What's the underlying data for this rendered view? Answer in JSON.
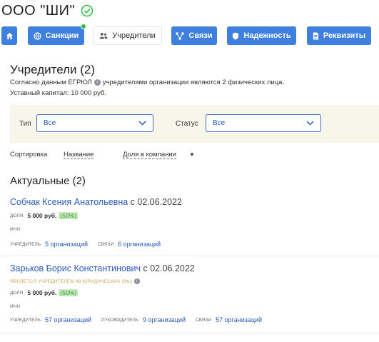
{
  "header": {
    "company_name": "ООО \"ШИ\"",
    "verified_icon": "check-circle-icon"
  },
  "tabs": [
    {
      "label": "",
      "icon": "home-icon"
    },
    {
      "label": "Санкции",
      "icon": "globe-icon",
      "badge": "green-dot"
    },
    {
      "label": "Учредители",
      "icon": "people-icon",
      "active": true
    },
    {
      "label": "Связи",
      "icon": "share-icon"
    },
    {
      "label": "Надежность",
      "icon": "shield-icon"
    },
    {
      "label": "Реквизиты",
      "icon": "document-icon"
    }
  ],
  "summary": {
    "title": "Учредители (2)",
    "text_before": "Согласно данным ЕГРЮЛ",
    "info_glyph": "i",
    "text_after": "учредителями организации являются 2 физических лица.",
    "capital": "Уставный капитал: 10 000 руб."
  },
  "filters": {
    "type_label": "Тип",
    "type_value": "Все",
    "status_label": "Статус",
    "status_value": "Все"
  },
  "sort": {
    "label": "Сортировка",
    "option1": "Название",
    "option2": "Доля в компании",
    "arrow": "▼"
  },
  "section": {
    "title": "Актуальные (2)"
  },
  "founders": [
    {
      "name": "Собчак Ксения Анатольевна",
      "since": "с 02.06.2022",
      "share_label": "ДОЛЯ",
      "share_amount": "5 000 руб.",
      "share_percent": "(50%)",
      "inn_label": "ИНН",
      "links": [
        {
          "label": "УЧРЕДИТЕЛЬ",
          "value": "5 организаций"
        },
        {
          "label": "СВЯЗИ",
          "value": "6 организаций"
        }
      ]
    },
    {
      "name": "Зарьков Борис Константинович",
      "since": "с 02.06.2022",
      "note": "ЯВЛЯЕТСЯ УЧРЕДИТЕЛЕМ 48 ЮРИДИЧЕСКИХ ЛИЦ",
      "share_label": "ДОЛЯ",
      "share_amount": "5 000 руб.",
      "share_percent": "(50%)",
      "inn_label": "ИНН",
      "links": [
        {
          "label": "УЧРЕДИТЕЛЬ",
          "value": "57 организаций"
        },
        {
          "label": "РУКОВОДИТЕЛЬ",
          "value": "9 организаций"
        },
        {
          "label": "СВЯЗИ",
          "value": "57 организаций"
        }
      ]
    }
  ],
  "colors": {
    "accent": "#3f7fe0",
    "link": "#2a5bb8",
    "filter_bg": "#f8f6ea",
    "share_bg": "#c8eec0",
    "note": "#d7a35a",
    "verified": "#2ebd42"
  }
}
